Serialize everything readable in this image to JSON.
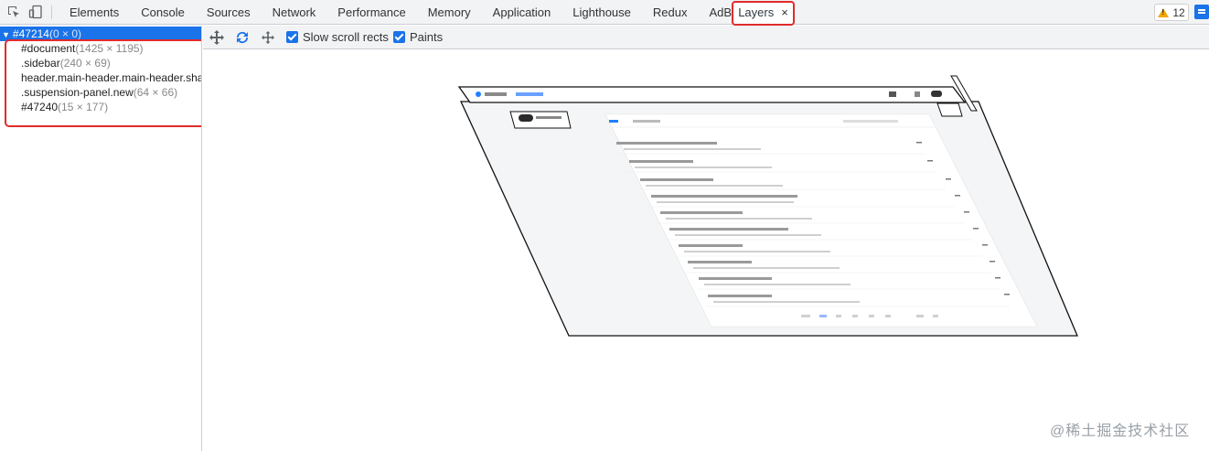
{
  "devtools": {
    "tabs": [
      "Elements",
      "Console",
      "Sources",
      "Network",
      "Performance",
      "Memory",
      "Application",
      "Lighthouse",
      "Redux",
      "AdBlock"
    ],
    "active_tab": "Layers",
    "active_tab_close": "×",
    "warnings_count": "12",
    "icons": [
      "inspect-element-icon",
      "device-toolbar-icon",
      "warning-icon",
      "chat-icon"
    ],
    "accent_color": "#1a73e8",
    "highlight_color": "#e12b2b"
  },
  "layer_tree": {
    "root": {
      "name": "#47214",
      "size": "(0 × 0)"
    },
    "items": [
      {
        "name": "#document",
        "size": "(1425 × 1195)"
      },
      {
        "name": ".sidebar",
        "size": "(240 × 69)"
      },
      {
        "name": "header.main-header.main-header.sha",
        "size": ""
      },
      {
        "name": ".suspension-panel.new",
        "size": "(64 × 66)"
      },
      {
        "name": "#47240",
        "size": "(15 × 177)"
      }
    ]
  },
  "layers_toolbar": {
    "icons": [
      "pan-mode-icon",
      "rotate-mode-icon",
      "reset-transform-icon"
    ],
    "slow_scroll_rects": {
      "label": "Slow scroll rects",
      "checked": true
    },
    "paints": {
      "label": "Paints",
      "checked": true
    }
  },
  "watermark": "@稀土掘金技术社区"
}
